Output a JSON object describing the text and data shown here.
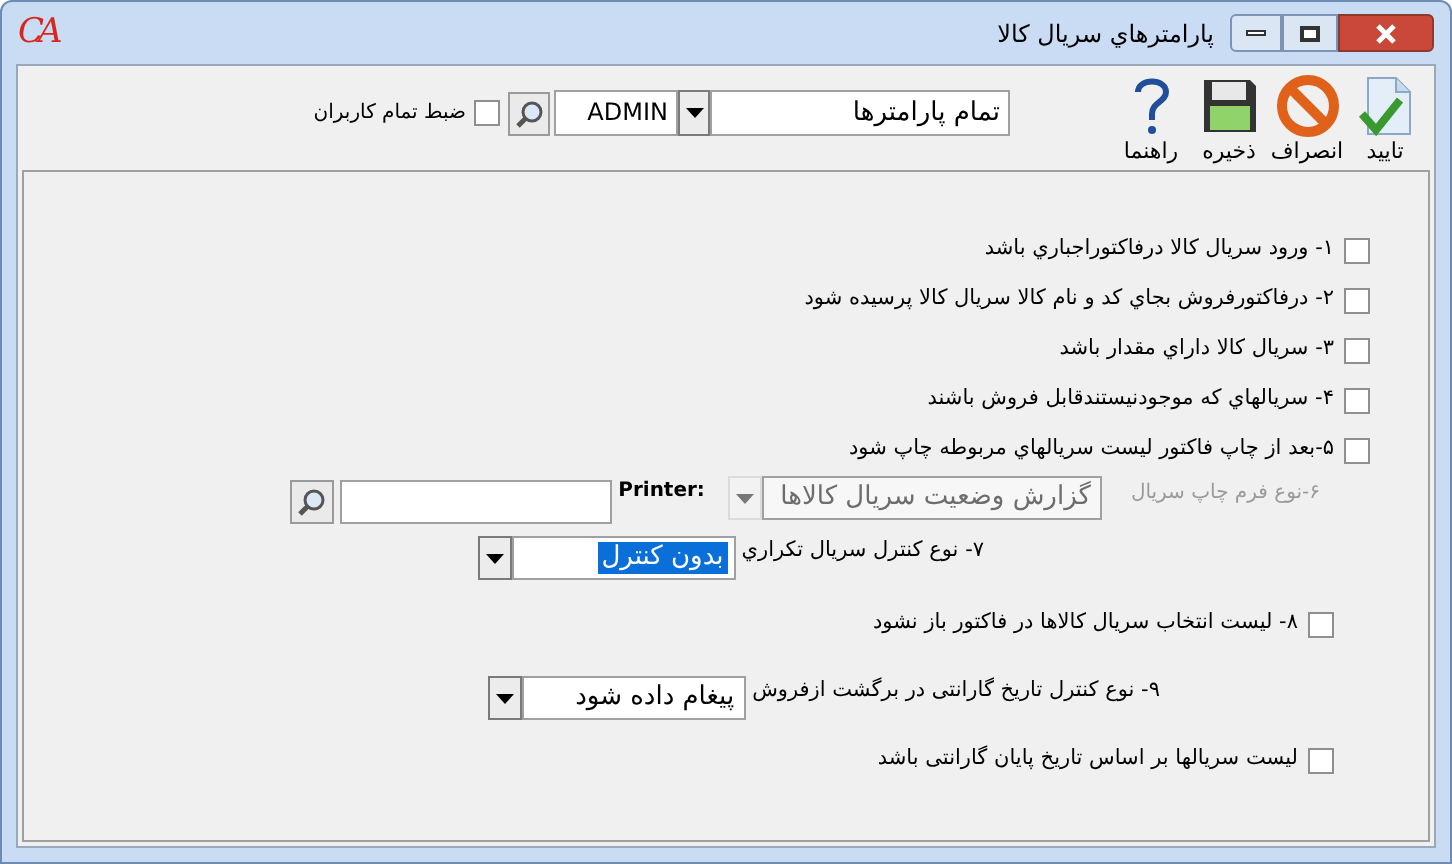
{
  "window": {
    "logo": "CA",
    "title": "پارامترهاي سریال کالا"
  },
  "toolbar": {
    "buttons": [
      {
        "kind": "confirm",
        "label": "تایید"
      },
      {
        "kind": "cancel",
        "label": "انصراف"
      },
      {
        "kind": "save",
        "label": "ذخیره"
      },
      {
        "kind": "help",
        "label": "راهنما"
      }
    ],
    "parameters_combo": {
      "value": "تمام پارامترها"
    },
    "user_combo": {
      "value": "ADMIN"
    },
    "all_users": {
      "label": "ضبط تمام کاربران",
      "checked": false
    }
  },
  "options": [
    {
      "kind": "checkbox",
      "label": "۱- ورود سریال کالا درفاکتوراجباري باشد",
      "checked": false
    },
    {
      "kind": "checkbox",
      "label": "۲- درفاکتورفروش بجاي کد و نام کالا سریال کالا پرسیده شود",
      "checked": false
    },
    {
      "kind": "checkbox",
      "label": "۳- سریال کالا داراي مقدار باشد",
      "checked": false
    },
    {
      "kind": "checkbox",
      "label": "۴- سریالهاي که موجودنیستندقابل فروش باشند",
      "checked": false
    },
    {
      "kind": "checkbox",
      "label": "۵-بعد از چاپ فاکتور لیست سریالهاي مربوطه چاپ شود",
      "checked": false
    },
    {
      "kind": "print_form",
      "label": "۶-نوع فرم چاپ سریال",
      "value": "گزارش وضعیت سریال کالاها",
      "disabled": true,
      "printer_label": "Printer:"
    },
    {
      "kind": "combo",
      "label": "۷- نوع کنترل سریال تکراري",
      "value": "بدون کنترل",
      "focused": true
    },
    {
      "kind": "checkbox",
      "label": "۸- لیست انتخاب سریال کالاها در فاکتور باز نشود",
      "checked": false
    },
    {
      "kind": "combo",
      "label": "۹- نوع کنترل تاریخ گارانتی در برگشت ازفروش",
      "value": "پیغام داده شود",
      "focused": false
    },
    {
      "kind": "checkbox",
      "label": "لیست سریالها بر اساس تاریخ پایان گارانتی باشد",
      "checked": false
    }
  ]
}
